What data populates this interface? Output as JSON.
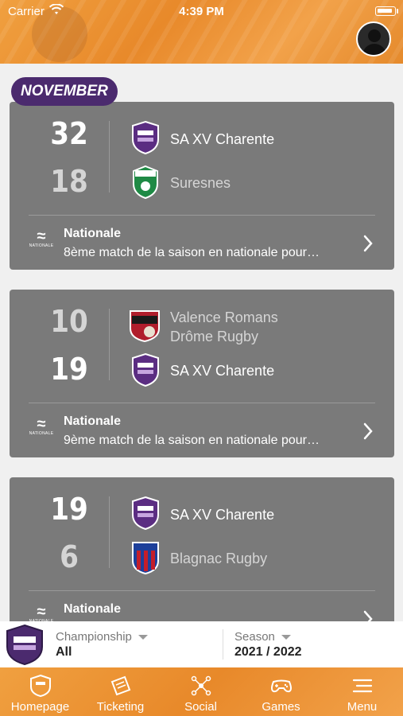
{
  "status_bar": {
    "carrier": "Carrier",
    "time": "4:39 PM"
  },
  "month_label": "NOVEMBER",
  "matches": [
    {
      "home": {
        "score": "32",
        "name": "SA XV Charente",
        "winner": true
      },
      "away": {
        "score": "18",
        "name": "Suresnes",
        "winner": false
      },
      "competition": "Nationale",
      "competition_logo_text": "NATIONALE",
      "description": "8ème match de la saison en nationale pour…"
    },
    {
      "home": {
        "score": "10",
        "name_line1": "Valence Romans",
        "name_line2": "Drôme Rugby",
        "winner": false
      },
      "away": {
        "score": "19",
        "name": "SA XV Charente",
        "winner": true
      },
      "competition": "Nationale",
      "competition_logo_text": "NATIONALE",
      "description": "9ème match de la saison en nationale pour…"
    },
    {
      "home": {
        "score": "19",
        "name": "SA XV Charente",
        "winner": true
      },
      "away": {
        "score": "6",
        "name": "Blagnac Rugby",
        "winner": false
      },
      "competition": "Nationale",
      "competition_logo_text": "NATIONALE"
    }
  ],
  "filters": {
    "championship_label": "Championship",
    "championship_value": "All",
    "season_label": "Season",
    "season_value": "2021 / 2022"
  },
  "tabs": [
    {
      "label": "Homepage",
      "icon": "shield-icon"
    },
    {
      "label": "Ticketing",
      "icon": "ticket-icon"
    },
    {
      "label": "Social",
      "icon": "network-icon"
    },
    {
      "label": "Games",
      "icon": "gamepad-icon"
    },
    {
      "label": "Menu",
      "icon": "menu-icon"
    }
  ],
  "colors": {
    "brand_orange": "#e8892a",
    "brand_purple": "#4b2a6e",
    "card_gray": "#7a7a7a"
  }
}
